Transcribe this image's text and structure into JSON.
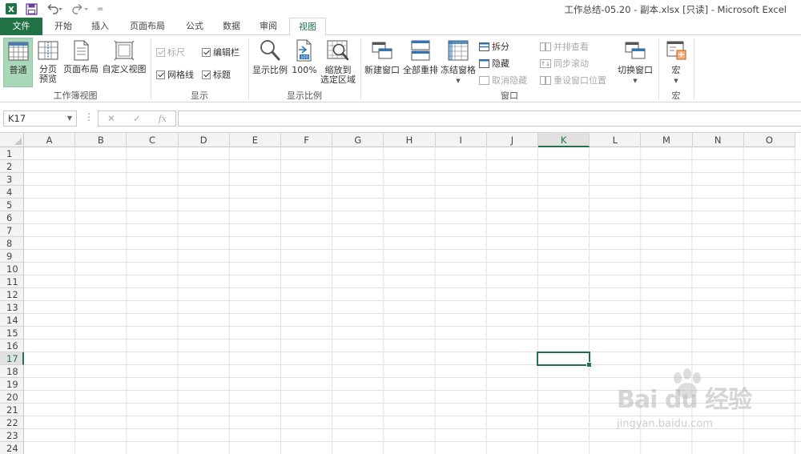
{
  "window": {
    "title": "工作总结-05.20 - 副本.xlsx  [只读] - Microsoft Excel",
    "qat_customize": "="
  },
  "tabs": [
    {
      "label": "文件"
    },
    {
      "label": "开始"
    },
    {
      "label": "插入"
    },
    {
      "label": "页面布局"
    },
    {
      "label": "公式"
    },
    {
      "label": "数据"
    },
    {
      "label": "审阅"
    },
    {
      "label": "视图"
    }
  ],
  "ribbon": {
    "workbook_views": {
      "label": "工作簿视图",
      "normal": "普通",
      "page_break_1": "分页",
      "page_break_2": "预览",
      "page_layout": "页面布局",
      "custom_views": "自定义视图"
    },
    "show": {
      "label": "显示",
      "ruler": "标尺",
      "formula_bar": "编辑栏",
      "gridlines": "网格线",
      "headings": "标题"
    },
    "zoom": {
      "label": "显示比例",
      "zoom": "显示比例",
      "hundred": "100%",
      "zoom_sel_1": "缩放到",
      "zoom_sel_2": "选定区域"
    },
    "window": {
      "label": "窗口",
      "new_window": "新建窗口",
      "arrange_all": "全部重排",
      "freeze_panes": "冻结窗格",
      "split": "拆分",
      "hide": "隐藏",
      "unhide": "取消隐藏",
      "side_by_side": "并排查看",
      "sync_scroll": "同步滚动",
      "reset_pos": "重设窗口位置",
      "switch_windows": "切换窗口"
    },
    "macros": {
      "label": "宏",
      "macros": "宏"
    }
  },
  "formula_bar": {
    "name_box": "K17",
    "more": "⋮",
    "cancel": "✕",
    "enter": "✓",
    "fx": "fx",
    "value": ""
  },
  "sheet": {
    "columns": [
      "A",
      "B",
      "C",
      "D",
      "E",
      "F",
      "G",
      "H",
      "I",
      "J",
      "K",
      "L",
      "M",
      "N",
      "O"
    ],
    "rows": [
      "1",
      "2",
      "3",
      "4",
      "5",
      "6",
      "7",
      "8",
      "9",
      "10",
      "11",
      "12",
      "13",
      "14",
      "15",
      "16",
      "17",
      "18",
      "19",
      "20",
      "21",
      "22",
      "23",
      "24"
    ],
    "active_column": "K",
    "active_row": "17"
  },
  "watermark": {
    "brand": "Bai du 经验",
    "url": "jingyan.baidu.com"
  },
  "colors": {
    "excel_green": "#217346",
    "selected_button": "#a9d8b8"
  }
}
